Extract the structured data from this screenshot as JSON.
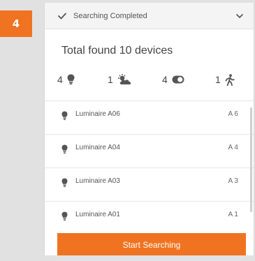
{
  "step": {
    "number": "4"
  },
  "header": {
    "title": "Searching Completed",
    "collapsed": false
  },
  "summary": {
    "text": "Total found 10 devices"
  },
  "counts": [
    {
      "value": "4",
      "icon": "bulb-icon"
    },
    {
      "value": "1",
      "icon": "daylight-icon"
    },
    {
      "value": "4",
      "icon": "switch-icon"
    },
    {
      "value": "1",
      "icon": "motion-icon"
    }
  ],
  "devices": [
    {
      "name": "Luminaire A06",
      "address": "A 6"
    },
    {
      "name": "Luminaire A04",
      "address": "A 4"
    },
    {
      "name": "Luminaire A03",
      "address": "A 3"
    },
    {
      "name": "Luminaire A01",
      "address": "A 1"
    }
  ],
  "button": {
    "label": "Start Searching"
  },
  "colors": {
    "accent": "#f07321",
    "header_bg": "#f4f4f4",
    "icon": "#555555"
  }
}
